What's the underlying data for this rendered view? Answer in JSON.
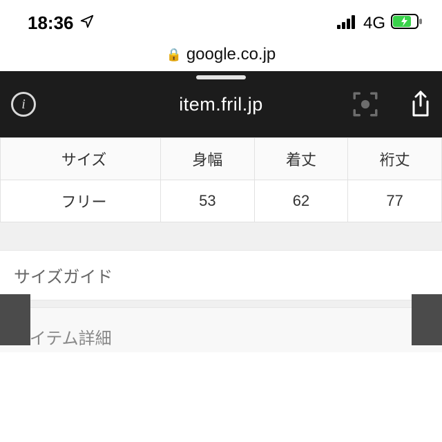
{
  "status": {
    "time": "18:36",
    "network": "4G"
  },
  "safari": {
    "host": "google.co.jp"
  },
  "embedded_bar": {
    "title": "item.fril.jp"
  },
  "table": {
    "headers": [
      "サイズ",
      "身幅",
      "着丈",
      "裄丈"
    ],
    "row": [
      "フリー",
      "53",
      "62",
      "77"
    ]
  },
  "sections": {
    "size_guide": "サイズガイド",
    "item_detail": "アイテム詳細"
  }
}
